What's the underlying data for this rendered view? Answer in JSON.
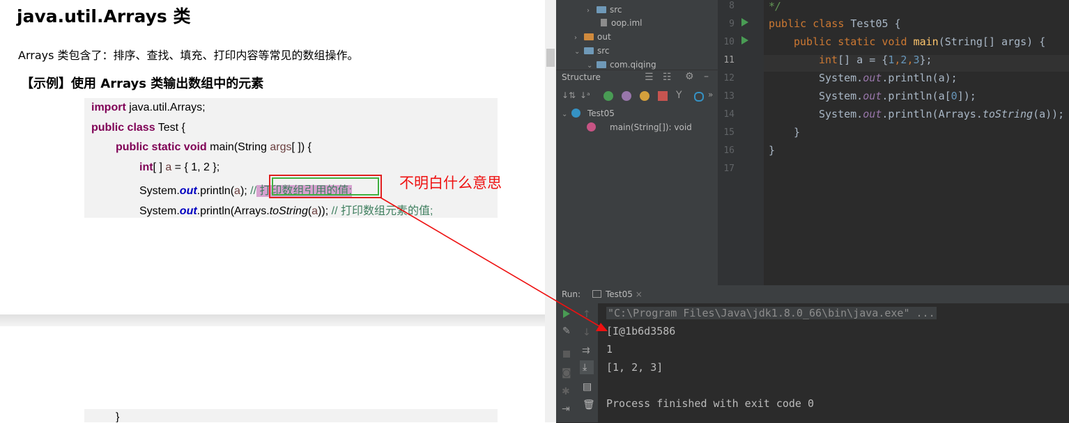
{
  "doc": {
    "title": "java.util.Arrays 类",
    "intro": "Arrays 类包含了：排序、查找、填充、打印内容等常见的数组操作。",
    "example_heading": "【示例】使用 Arrays 类输出数组中的元素",
    "code": {
      "l1_kw": "import",
      "l1_rest": " java.util.Arrays;",
      "l2_kw": "public class",
      "l2_rest": " Test {",
      "l3_kw": "public static void",
      "l3_a": " main(String ",
      "l3_var": "args",
      "l3_b": "[ ]) {",
      "l4_kw": "int",
      "l4_a": "[ ] ",
      "l4_var": "a",
      "l4_b": " = { 1, 2 };",
      "l5_a": "System.",
      "l5_fld": "out",
      "l5_b": ".println(",
      "l5_var": "a",
      "l5_c": "); ",
      "l5_cmt": "//",
      "l5_hl": " 打印数组引用的值;",
      "l6_a": "System.",
      "l6_fld": "out",
      "l6_b": ".println(Arrays.",
      "l6_itl": "toString",
      "l6_c": "(",
      "l6_var": "a",
      "l6_d": ")); ",
      "l6_cmt": "// 打印数组元素的值;",
      "closing": "}"
    },
    "annotation": "不明白什么意思"
  },
  "project_tree": {
    "items": [
      "src",
      "oop.iml",
      "out",
      "src",
      "com.qiqing"
    ]
  },
  "structure": {
    "title": "Structure",
    "class_name": "Test05",
    "method": "main(String[]): void"
  },
  "editor": {
    "line_numbers": [
      "8",
      "9",
      "10",
      "11",
      "12",
      "13",
      "14",
      "15",
      "16",
      "17"
    ],
    "l8": "*/",
    "l9_k": "public class",
    "l9_b": " Test05 {",
    "l10_k": "public static void",
    "l10_fn": "main",
    "l10_b": "(String[] args) {",
    "l11_k": "int",
    "l11_a": "[] a = {",
    "l11_n1": "1",
    "l11_c1": ",",
    "l11_n2": "2",
    "l11_c2": ",",
    "l11_n3": "3",
    "l11_d": "};",
    "l12_a": "System.",
    "l12_out": "out",
    "l12_b": ".println(a);",
    "l13_a": "System.",
    "l13_out": "out",
    "l13_b": ".println(a[",
    "l13_n": "0",
    "l13_c": "]);",
    "l14_a": "System.",
    "l14_out": "out",
    "l14_b": ".println(Arrays.",
    "l14_it": "toString",
    "l14_c": "(a));",
    "l15": "}",
    "l16": "}"
  },
  "run": {
    "label": "Run:",
    "tab": "Test05",
    "cmd": "\"C:\\Program Files\\Java\\jdk1.8.0_66\\bin\\java.exe\" ...",
    "out1": "[I@1b6d3586",
    "out2": "1",
    "out3": "[1, 2, 3]",
    "exit": "Process finished with exit code 0"
  }
}
